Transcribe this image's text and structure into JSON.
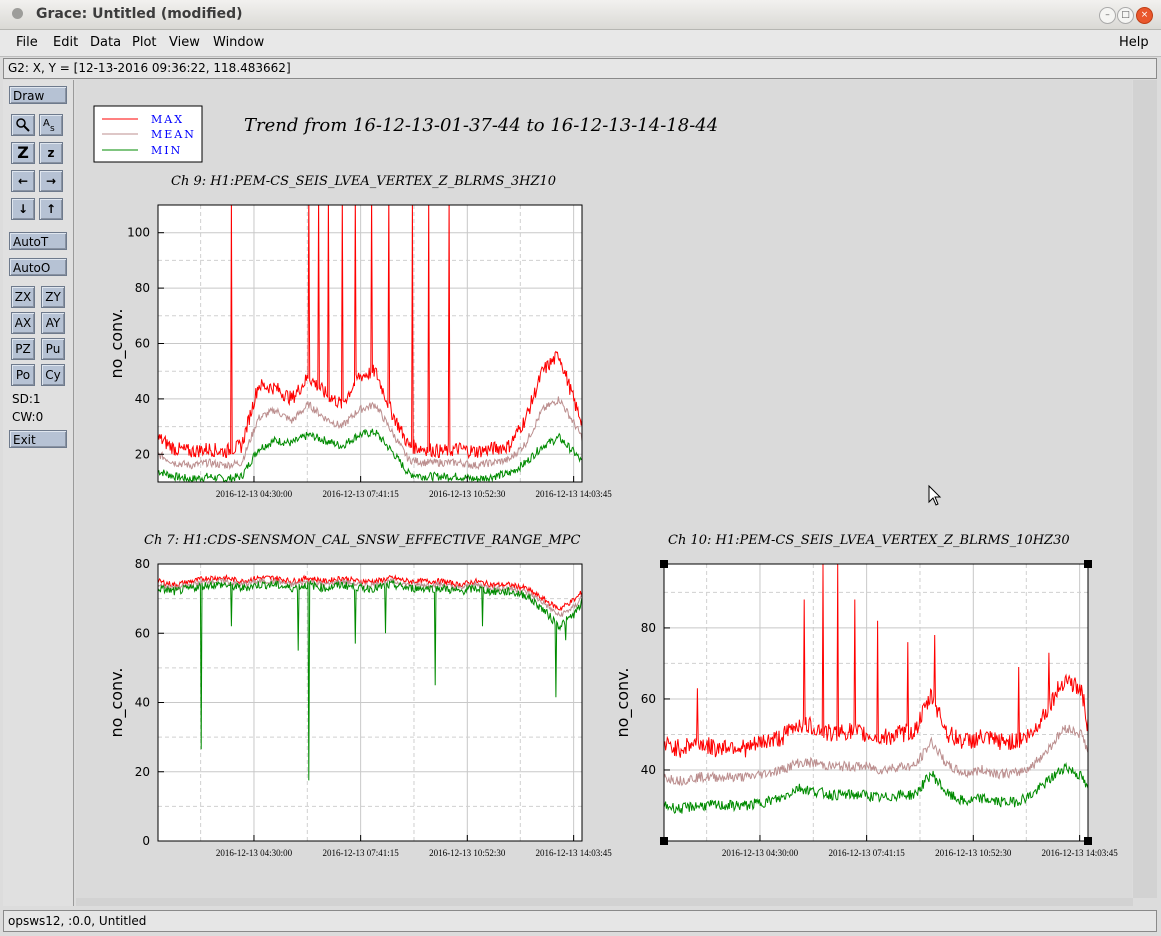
{
  "window": {
    "title": "Grace: Untitled (modified)"
  },
  "menu": {
    "file": "File",
    "edit": "Edit",
    "data": "Data",
    "plot": "Plot",
    "view": "View",
    "window": "Window",
    "help": "Help"
  },
  "locator": {
    "text": "G2: X, Y = [12-13-2016 09:36:22, 118.483662]"
  },
  "toolbar": {
    "draw": "Draw",
    "autot": "AutoT",
    "autoo": "AutoO",
    "zx": "ZX",
    "zy": "ZY",
    "ax": "AX",
    "ay": "AY",
    "pz": "PZ",
    "pu": "Pu",
    "po": "Po",
    "cy": "Cy",
    "sd": "SD:1",
    "cw": "CW:0",
    "exit": "Exit",
    "zoom_big": "Z",
    "zoom_small": "z"
  },
  "status": {
    "text": "opsws12, :0.0, Untitled"
  },
  "colors": {
    "max": "#ff0000",
    "mean": "#bc8f8f",
    "min": "#008b00",
    "legend_text": "#0000ff"
  },
  "chart_data": [
    {
      "type": "line",
      "title": "Ch 9: H1:PEM-CS_SEIS_LVEA_VERTEX_Z_BLRMS_3HZ10",
      "ylabel": "no_conv.",
      "xlabel": "",
      "main_title": "Trend from 16-12-13-01-37-44 to 16-12-13-14-18-44",
      "ylim": [
        10,
        110
      ],
      "yticks": [
        20,
        40,
        60,
        80,
        100
      ],
      "xticks": [
        "2016-12-13 04:30:00",
        "2016-12-13 07:41:15",
        "2016-12-13 10:52:30",
        "2016-12-13 14:03:45"
      ],
      "grid": true,
      "legend": [
        "MAX",
        "MEAN",
        "MIN"
      ],
      "legend_position": "top-left",
      "x_hours": [
        0,
        0.5,
        1,
        1.5,
        2,
        2.5,
        3,
        3.5,
        4,
        4.5,
        5,
        5.5,
        6,
        6.5,
        7,
        7.5,
        8,
        8.5,
        9,
        9.5,
        10,
        10.5,
        11,
        11.5,
        12,
        12.5,
        12.68
      ],
      "series": [
        {
          "name": "MAX",
          "values": [
            26,
            22,
            21,
            22,
            21,
            23,
            45,
            44,
            40,
            48,
            42,
            38,
            48,
            50,
            35,
            23,
            22,
            21,
            22,
            21,
            22,
            23,
            33,
            50,
            56,
            37,
            32
          ],
          "spikes_x_hours": [
            2.2,
            4.5,
            4.8,
            5.1,
            5.5,
            5.9,
            6.4,
            6.9,
            7.6,
            8.1,
            8.7
          ]
        },
        {
          "name": "MEAN",
          "values": [
            20,
            17,
            16,
            17,
            16,
            17,
            33,
            36,
            32,
            38,
            33,
            30,
            36,
            38,
            28,
            18,
            17,
            17,
            17,
            16,
            17,
            18,
            24,
            36,
            40,
            30,
            26
          ]
        },
        {
          "name": "MIN",
          "values": [
            14,
            12,
            11,
            12,
            11,
            12,
            22,
            25,
            24,
            27,
            25,
            23,
            27,
            28,
            21,
            13,
            12,
            12,
            12,
            11,
            12,
            13,
            17,
            23,
            26,
            20,
            17
          ]
        }
      ]
    },
    {
      "type": "line",
      "title": "Ch 7: H1:CDS-SENSMON_CAL_SNSW_EFFECTIVE_RANGE_MPC",
      "ylabel": "no_conv.",
      "xlabel": "",
      "ylim": [
        0,
        80
      ],
      "yticks": [
        0,
        20,
        40,
        60,
        80
      ],
      "xticks": [
        "2016-12-13 04:30:00",
        "2016-12-13 07:41:15",
        "2016-12-13 10:52:30",
        "2016-12-13 14:03:45"
      ],
      "grid": true,
      "x_hours": [
        0,
        0.5,
        1,
        1.5,
        2,
        2.5,
        3,
        3.5,
        4,
        4.5,
        5,
        5.5,
        6,
        6.5,
        7,
        7.5,
        8,
        8.5,
        9,
        9.5,
        10,
        10.5,
        11,
        11.5,
        12,
        12.5,
        12.68
      ],
      "series": [
        {
          "name": "MAX",
          "values": [
            75,
            74,
            75,
            76,
            76,
            75,
            76,
            76,
            75,
            76,
            75,
            76,
            75,
            75,
            76,
            75,
            75,
            75,
            74,
            75,
            74,
            74,
            73,
            70,
            67,
            70,
            72
          ]
        },
        {
          "name": "MEAN",
          "values": [
            74,
            73,
            74,
            75,
            75,
            74,
            75,
            75,
            74,
            75,
            74,
            75,
            74,
            74,
            75,
            74,
            74,
            74,
            73,
            74,
            73,
            73,
            72,
            69,
            65,
            68,
            71
          ]
        },
        {
          "name": "MIN",
          "values": [
            73,
            72,
            73,
            74,
            74,
            73,
            74,
            74,
            73,
            74,
            73,
            74,
            73,
            73,
            74,
            73,
            73,
            73,
            72,
            73,
            72,
            72,
            71,
            67,
            62,
            66,
            69
          ],
          "dips": [
            [
              1.3,
              26.5
            ],
            [
              4.5,
              17.5
            ],
            [
              8.3,
              45
            ],
            [
              11.9,
              41.5
            ],
            [
              2.2,
              62
            ],
            [
              4.2,
              55
            ],
            [
              5.9,
              57
            ],
            [
              6.8,
              60
            ],
            [
              9.7,
              62
            ],
            [
              12.2,
              58
            ]
          ]
        }
      ]
    },
    {
      "type": "line",
      "title": "Ch 10: H1:PEM-CS_SEIS_LVEA_VERTEX_Z_BLRMS_10HZ30",
      "ylabel": "no_conv.",
      "xlabel": "",
      "ylim": [
        20,
        98
      ],
      "yticks": [
        40,
        60,
        80
      ],
      "xticks": [
        "2016-12-13 04:30:00",
        "2016-12-13 07:41:15",
        "2016-12-13 10:52:30",
        "2016-12-13 14:03:45"
      ],
      "grid": true,
      "x_hours": [
        0,
        0.5,
        1,
        1.5,
        2,
        2.5,
        3,
        3.5,
        4,
        4.5,
        5,
        5.5,
        6,
        6.5,
        7,
        7.5,
        8,
        8.5,
        9,
        9.5,
        10,
        10.5,
        11,
        11.5,
        12,
        12.5,
        12.68
      ],
      "series": [
        {
          "name": "MAX",
          "values": [
            47,
            46,
            48,
            46,
            47,
            46,
            48,
            49,
            53,
            52,
            50,
            51,
            50,
            49,
            50,
            51,
            61,
            50,
            48,
            49,
            48,
            48,
            50,
            58,
            66,
            62,
            52
          ],
          "spikes": [
            [
              1.0,
              63
            ],
            [
              4.2,
              88
            ],
            [
              4.75,
              98
            ],
            [
              5.2,
              98
            ],
            [
              5.7,
              88
            ],
            [
              6.4,
              82
            ],
            [
              7.3,
              76
            ],
            [
              8.1,
              78
            ],
            [
              10.6,
              69
            ],
            [
              11.5,
              73
            ]
          ]
        },
        {
          "name": "MEAN",
          "values": [
            38,
            37,
            38,
            38,
            38,
            38,
            39,
            40,
            42,
            42,
            41,
            41,
            41,
            40,
            41,
            41,
            48,
            41,
            39,
            40,
            39,
            39,
            41,
            46,
            52,
            50,
            45
          ]
        },
        {
          "name": "MIN",
          "values": [
            30,
            29,
            30,
            30,
            30,
            30,
            31,
            32,
            35,
            34,
            33,
            33,
            33,
            32,
            33,
            33,
            39,
            33,
            31,
            32,
            31,
            31,
            33,
            37,
            41,
            38,
            34
          ]
        }
      ]
    }
  ]
}
